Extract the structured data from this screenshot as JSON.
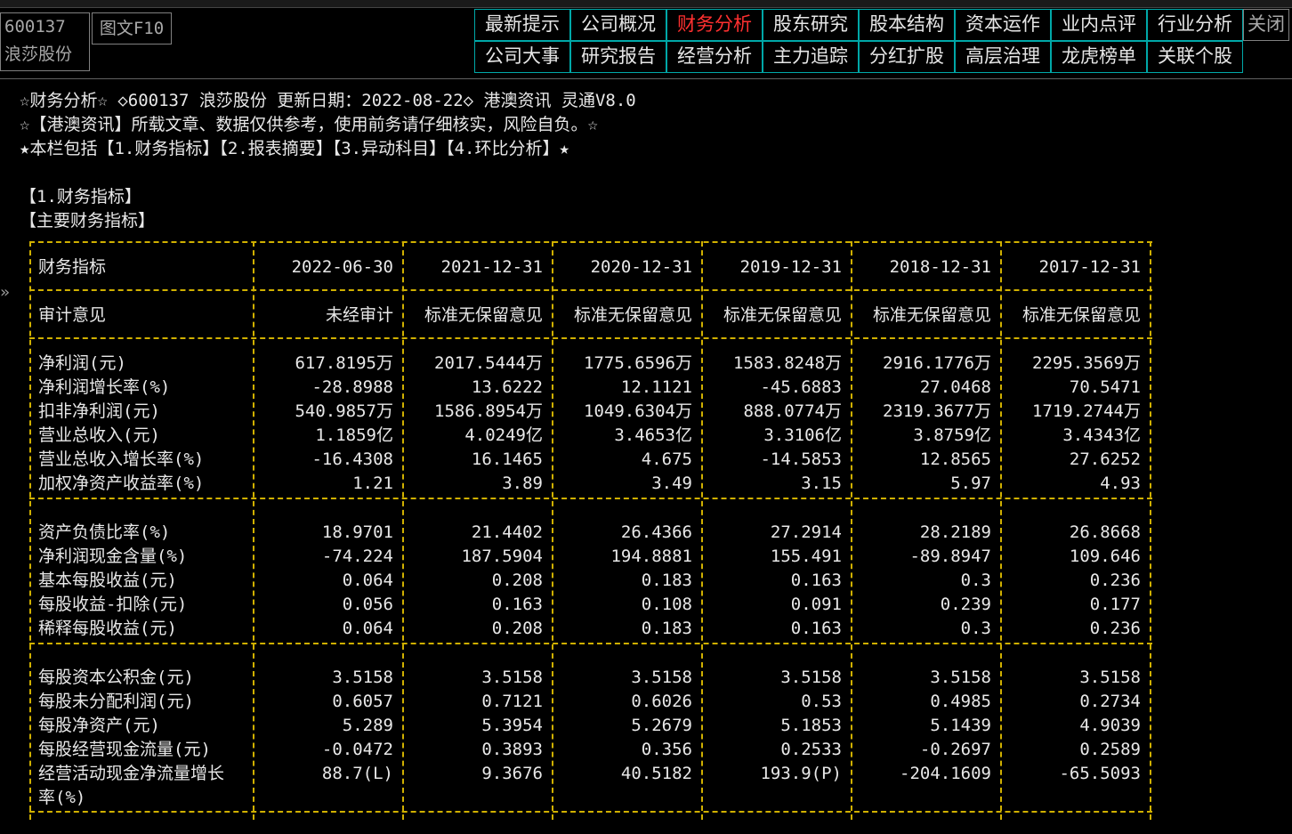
{
  "stock": {
    "code": "600137",
    "name": "浪莎股份",
    "f10_tab": "图文F10"
  },
  "nav": {
    "row1": [
      "最新提示",
      "公司概况",
      "财务分析",
      "股东研究",
      "股本结构",
      "资本运作",
      "业内点评",
      "行业分析"
    ],
    "row2": [
      "公司大事",
      "研究报告",
      "经营分析",
      "主力追踪",
      "分红扩股",
      "高层治理",
      "龙虎榜单",
      "关联个股"
    ],
    "active": "财务分析",
    "close_label": "关闭"
  },
  "header_lines": [
    "☆财务分析☆ ◇600137 浪莎股份 更新日期：2022-08-22◇ 港澳资讯 灵通V8.0",
    "☆【港澳资讯】所载文章、数据仅供参考，使用前务请仔细核实，风险自负。☆",
    "★本栏包括【1.财务指标】【2.报表摘要】【3.异动科目】【4.环比分析】★"
  ],
  "section_title": "【1.财务指标】",
  "subsection_title": "【主要财务指标】",
  "side_arrow": "»",
  "table": {
    "header_label": "财务指标",
    "columns": [
      "2022-06-30",
      "2021-12-31",
      "2020-12-31",
      "2019-12-31",
      "2018-12-31",
      "2017-12-31"
    ],
    "audit_label": "审计意见",
    "audit": [
      "未经审计",
      "标准无保留意见",
      "标准无保留意见",
      "标准无保留意见",
      "标准无保留意见",
      "标准无保留意见"
    ],
    "groups": [
      [
        {
          "label": "净利润(元)",
          "values": [
            "617.8195万",
            "2017.5444万",
            "1775.6596万",
            "1583.8248万",
            "2916.1776万",
            "2295.3569万"
          ]
        },
        {
          "label": "净利润增长率(%)",
          "values": [
            "-28.8988",
            "13.6222",
            "12.1121",
            "-45.6883",
            "27.0468",
            "70.5471"
          ]
        },
        {
          "label": "扣非净利润(元)",
          "values": [
            "540.9857万",
            "1586.8954万",
            "1049.6304万",
            "888.0774万",
            "2319.3677万",
            "1719.2744万"
          ]
        },
        {
          "label": "营业总收入(元)",
          "values": [
            "1.1859亿",
            "4.0249亿",
            "3.4653亿",
            "3.3106亿",
            "3.8759亿",
            "3.4343亿"
          ]
        },
        {
          "label": "营业总收入增长率(%)",
          "values": [
            "-16.4308",
            "16.1465",
            "4.675",
            "-14.5853",
            "12.8565",
            "27.6252"
          ]
        },
        {
          "label": "加权净资产收益率(%)",
          "values": [
            "1.21",
            "3.89",
            "3.49",
            "3.15",
            "5.97",
            "4.93"
          ]
        }
      ],
      [
        {
          "label": "资产负债比率(%)",
          "values": [
            "18.9701",
            "21.4402",
            "26.4366",
            "27.2914",
            "28.2189",
            "26.8668"
          ]
        },
        {
          "label": "净利润现金含量(%)",
          "values": [
            "-74.224",
            "187.5904",
            "194.8881",
            "155.491",
            "-89.8947",
            "109.646"
          ]
        },
        {
          "label": "基本每股收益(元)",
          "values": [
            "0.064",
            "0.208",
            "0.183",
            "0.163",
            "0.3",
            "0.236"
          ]
        },
        {
          "label": "每股收益-扣除(元)",
          "values": [
            "0.056",
            "0.163",
            "0.108",
            "0.091",
            "0.239",
            "0.177"
          ]
        },
        {
          "label": "稀释每股收益(元)",
          "values": [
            "0.064",
            "0.208",
            "0.183",
            "0.163",
            "0.3",
            "0.236"
          ]
        }
      ],
      [
        {
          "label": "每股资本公积金(元)",
          "values": [
            "3.5158",
            "3.5158",
            "3.5158",
            "3.5158",
            "3.5158",
            "3.5158"
          ]
        },
        {
          "label": "每股未分配利润(元)",
          "values": [
            "0.6057",
            "0.7121",
            "0.6026",
            "0.53",
            "0.4985",
            "0.2734"
          ]
        },
        {
          "label": "每股净资产(元)",
          "values": [
            "5.289",
            "5.3954",
            "5.2679",
            "5.1853",
            "5.1439",
            "4.9039"
          ]
        },
        {
          "label": "每股经营现金流量(元)",
          "values": [
            "-0.0472",
            "0.3893",
            "0.356",
            "0.2533",
            "-0.2697",
            "0.2589"
          ]
        },
        {
          "label": "经营活动现金净流量增长",
          "label2": "率(%)",
          "values": [
            "88.7(L)",
            "9.3676",
            "40.5182",
            "193.9(P)",
            "-204.1609",
            "-65.5093"
          ]
        }
      ]
    ]
  }
}
